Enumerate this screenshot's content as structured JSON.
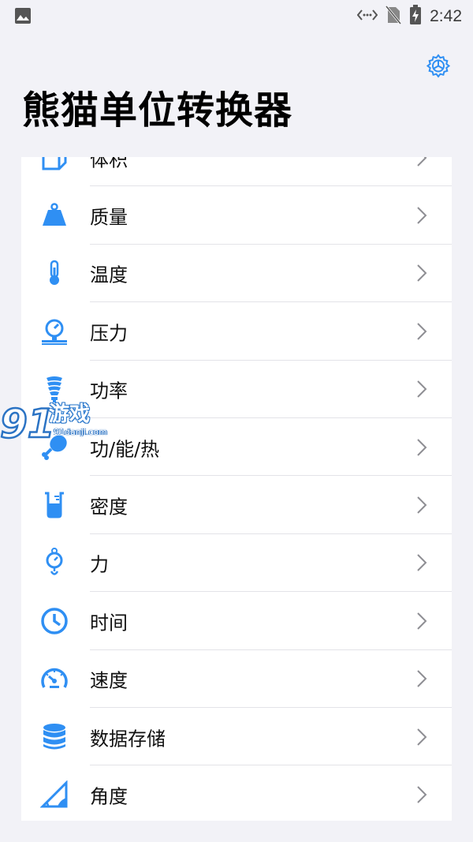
{
  "status_bar": {
    "time": "2:42",
    "icons": [
      "image-icon",
      "data-transfer-icon",
      "no-sim-icon",
      "battery-charging-icon"
    ]
  },
  "header": {
    "title": "熊猫单位转换器",
    "settings_icon": "gear-icon"
  },
  "colors": {
    "accent": "#2f8ff3",
    "background": "#f2f2f7",
    "card": "#ffffff",
    "chevron": "#8e8e93"
  },
  "list": {
    "items": [
      {
        "label": "体积",
        "icon": "volume-cube-icon"
      },
      {
        "label": "质量",
        "icon": "weight-icon"
      },
      {
        "label": "温度",
        "icon": "thermometer-icon"
      },
      {
        "label": "压力",
        "icon": "pressure-gauge-icon"
      },
      {
        "label": "功率",
        "icon": "lightbulb-icon"
      },
      {
        "label": "功/能/热",
        "icon": "drumstick-icon"
      },
      {
        "label": "密度",
        "icon": "beaker-icon"
      },
      {
        "label": "力",
        "icon": "spring-scale-icon"
      },
      {
        "label": "时间",
        "icon": "clock-icon"
      },
      {
        "label": "速度",
        "icon": "speedometer-icon"
      },
      {
        "label": "数据存储",
        "icon": "database-icon"
      },
      {
        "label": "角度",
        "icon": "angle-ruler-icon"
      }
    ]
  },
  "watermark": {
    "brand": "游戏",
    "domain": "91danji.com"
  }
}
